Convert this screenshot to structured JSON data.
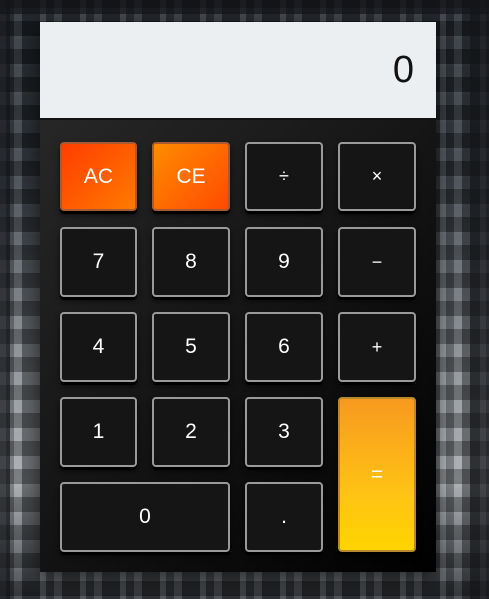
{
  "display": {
    "value": "0"
  },
  "keys": {
    "ac": "AC",
    "ce": "CE",
    "divide": "÷",
    "multiply": "×",
    "seven": "7",
    "eight": "8",
    "nine": "9",
    "minus": "−",
    "four": "4",
    "five": "5",
    "six": "6",
    "plus": "+",
    "one": "1",
    "two": "2",
    "three": "3",
    "equals": "=",
    "zero": "0",
    "decimal": "."
  },
  "colors": {
    "display_bg": "#eceff1",
    "body_dark": "#151515",
    "accent_orange": "#ff5a00",
    "equals_yellow": "#ffc414"
  }
}
